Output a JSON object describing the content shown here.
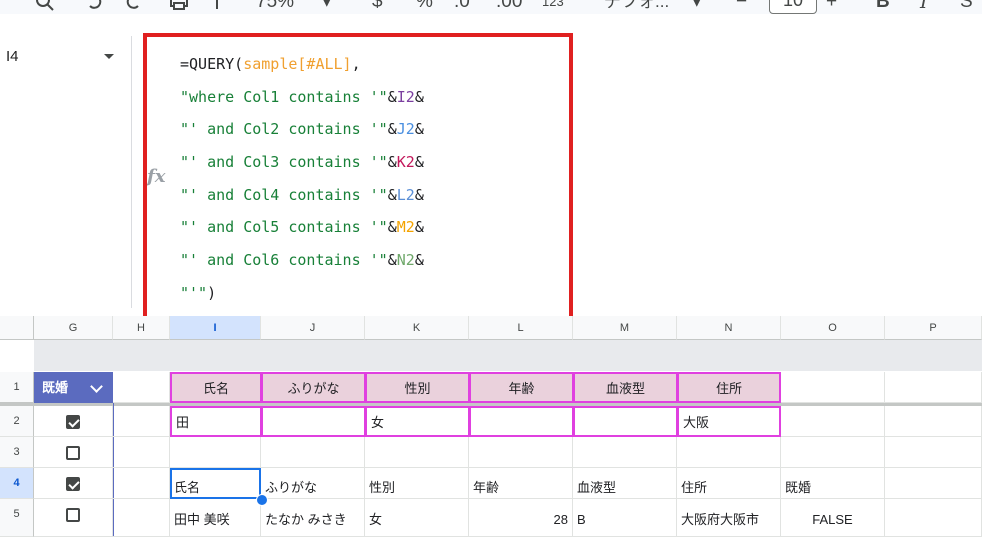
{
  "toolbar": {
    "zoom": "75%",
    "format_percent": "%",
    "format_123": "123",
    "font_name": "デフォ...",
    "font_size": "10",
    "bold": "B",
    "italic": "I"
  },
  "formula_bar": {
    "name_box": "I4",
    "fx": "fx",
    "lines": [
      [
        {
          "t": "=QUERY(",
          "c": "fn"
        },
        {
          "t": "sample[#ALL]",
          "c": "rng"
        },
        {
          "t": ",",
          "c": "op"
        }
      ],
      [
        {
          "t": "\"where Col1 contains '\"",
          "c": "str"
        },
        {
          "t": "&",
          "c": "op"
        },
        {
          "t": "I2",
          "c": "I2"
        },
        {
          "t": "&",
          "c": "op"
        }
      ],
      [
        {
          "t": "\"' and Col2 contains '\"",
          "c": "str"
        },
        {
          "t": "&",
          "c": "op"
        },
        {
          "t": "J2",
          "c": "J2"
        },
        {
          "t": "&",
          "c": "op"
        }
      ],
      [
        {
          "t": "\"' and Col3 contains '\"",
          "c": "str"
        },
        {
          "t": "&",
          "c": "op"
        },
        {
          "t": "K2",
          "c": "K2"
        },
        {
          "t": "&",
          "c": "op"
        }
      ],
      [
        {
          "t": "\"' and Col4 contains '\"",
          "c": "str"
        },
        {
          "t": "&",
          "c": "op"
        },
        {
          "t": "L2",
          "c": "L2"
        },
        {
          "t": "&",
          "c": "op"
        }
      ],
      [
        {
          "t": "\"' and Col5 contains '\"",
          "c": "str"
        },
        {
          "t": "&",
          "c": "op"
        },
        {
          "t": "M2",
          "c": "M2"
        },
        {
          "t": "&",
          "c": "op"
        }
      ],
      [
        {
          "t": "\"' and Col6 contains '\"",
          "c": "str"
        },
        {
          "t": "&",
          "c": "op"
        },
        {
          "t": "N2",
          "c": "N2"
        },
        {
          "t": "&",
          "c": "op"
        }
      ],
      [
        {
          "t": "\"'\"",
          "c": "str"
        },
        {
          "t": ")",
          "c": "op"
        }
      ]
    ]
  },
  "columns": [
    "G",
    "H",
    "I",
    "J",
    "K",
    "L",
    "M",
    "N",
    "O",
    "P"
  ],
  "rows": [
    "1",
    "2",
    "3",
    "4",
    "5"
  ],
  "filter_chip": "既婚",
  "header_row": [
    "氏名",
    "ふりがな",
    "性別",
    "年齢",
    "血液型",
    "住所"
  ],
  "input_row": [
    "田",
    "",
    "女",
    "",
    "",
    "大阪"
  ],
  "checkboxes": [
    true,
    false,
    true,
    false
  ],
  "result_header": [
    "氏名",
    "ふりがな",
    "性別",
    "年齢",
    "血液型",
    "住所",
    "既婚"
  ],
  "result_row": [
    "田中 美咲",
    "たなか みさき",
    "女",
    "28",
    "B",
    "大阪府大阪市",
    "FALSE"
  ],
  "colors": {
    "accent": "#1a73e8",
    "header_fill": "#ead1dc",
    "header_border": "#e040e0",
    "chip": "#5b6bbf",
    "highlight": "#e02020"
  }
}
